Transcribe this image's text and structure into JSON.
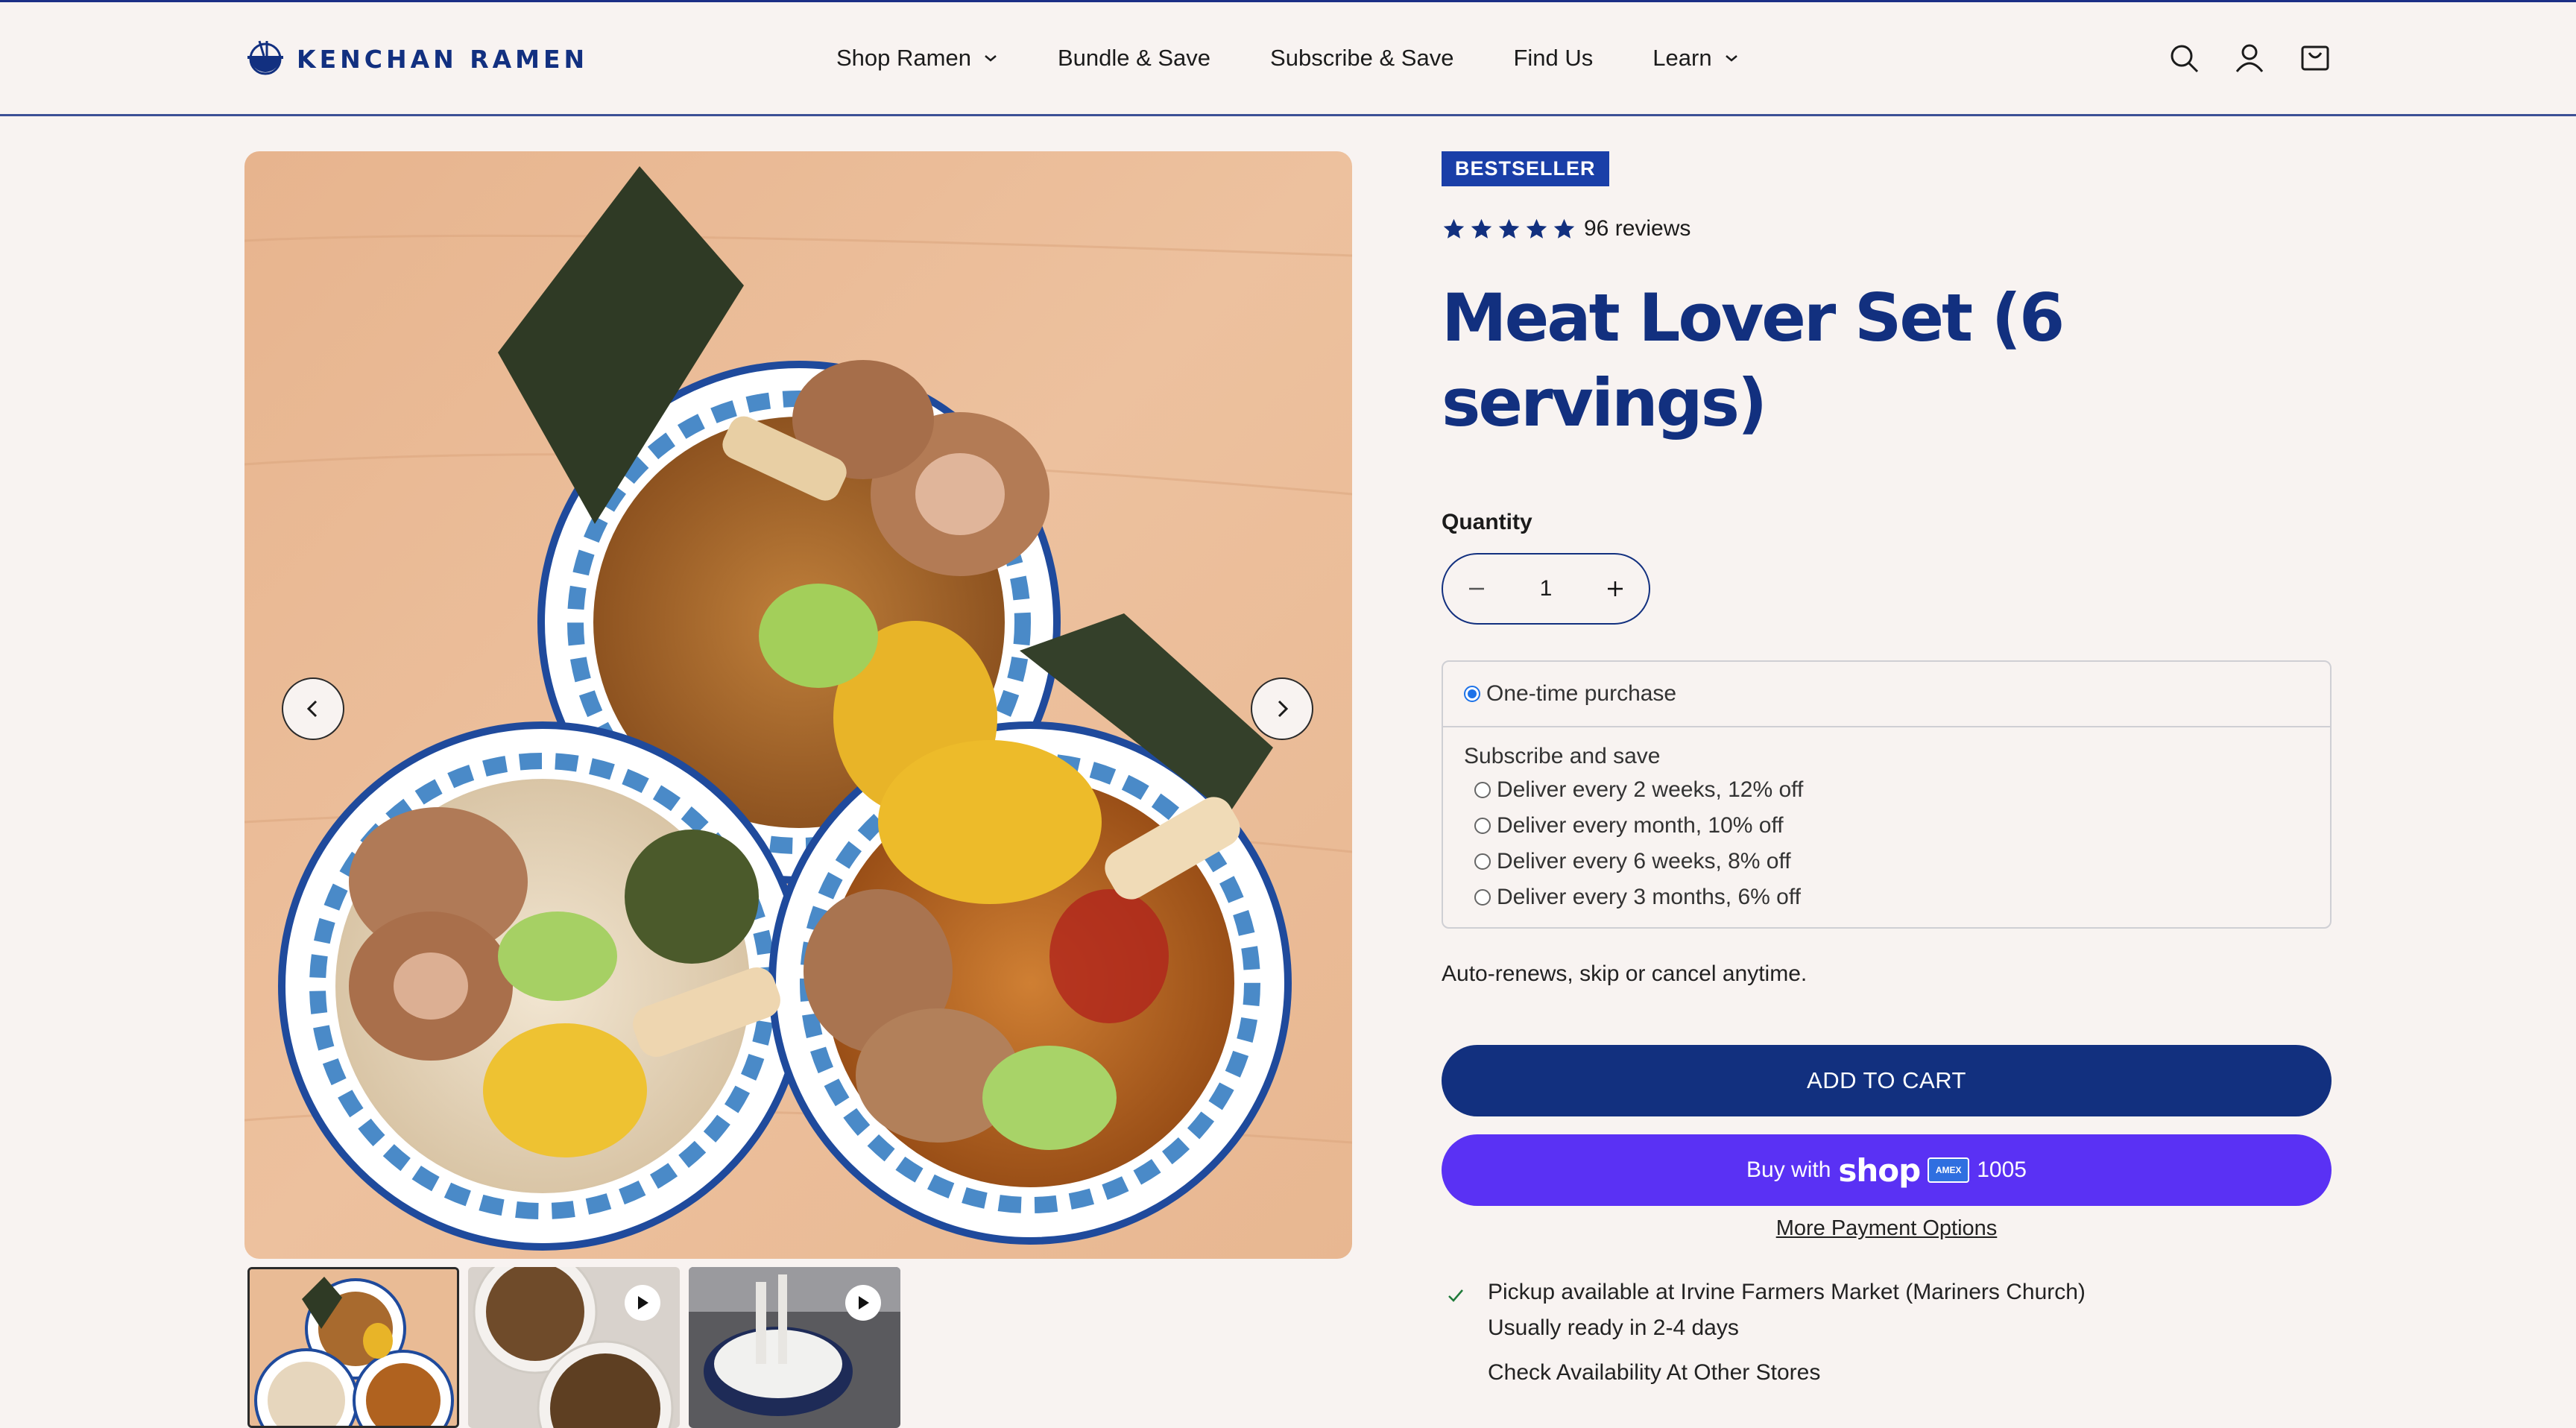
{
  "brand": {
    "name": "KENCHAN RAMEN"
  },
  "nav": {
    "items": [
      {
        "label": "Shop Ramen",
        "dropdown": true
      },
      {
        "label": "Bundle & Save",
        "dropdown": false
      },
      {
        "label": "Subscribe & Save",
        "dropdown": false
      },
      {
        "label": "Find Us",
        "dropdown": false
      },
      {
        "label": "Learn",
        "dropdown": true
      }
    ],
    "icons": [
      "search-icon",
      "account-icon",
      "cart-icon"
    ]
  },
  "gallery": {
    "main_image": "three ramen bowls on wooden table",
    "thumbnails": [
      {
        "name": "ramen-bowls-thumb",
        "video": false,
        "active": true
      },
      {
        "name": "broth-bowls-thumb",
        "video": true,
        "active": false
      },
      {
        "name": "noodle-pot-thumb",
        "video": true,
        "active": false
      }
    ]
  },
  "product": {
    "badge": "BESTSELLER",
    "rating": 5,
    "reviews": "96 reviews",
    "title": "Meat Lover Set (6 servings)",
    "quantity_label": "Quantity",
    "quantity": "1"
  },
  "purchase": {
    "one_time": "One-time purchase",
    "subscribe_title": "Subscribe and save",
    "options": [
      "Deliver every 2 weeks, 12% off",
      "Deliver every month, 10% off",
      "Deliver every 6 weeks, 8% off",
      "Deliver every 3 months, 6% off"
    ],
    "auto_renew": "Auto-renews, skip or cancel anytime."
  },
  "buttons": {
    "add_to_cart": "ADD TO CART",
    "buy_with": "Buy with",
    "shop_logo": "shop",
    "card_last": "1005",
    "more_payment": "More Payment Options"
  },
  "pickup": {
    "line1": "Pickup available at Irvine Farmers Market (Mariners Church)",
    "line2": "Usually ready in 2-4 days",
    "line3": "Check Availability At Other Stores"
  },
  "colors": {
    "brand_blue": "#12307f",
    "badge_blue": "#1a3fa8",
    "shop_purple": "#5a31f4",
    "background": "#f8f3f1"
  }
}
